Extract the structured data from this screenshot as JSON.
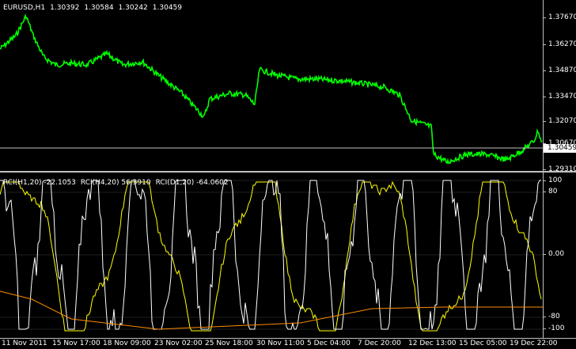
{
  "header": {
    "symbol": "EURUSD,H1",
    "open": "1.30392",
    "high": "1.30584",
    "low": "1.30242",
    "close": "1.30459"
  },
  "price_axis": {
    "ticks": [
      "1.37670",
      "1.36270",
      "1.34870",
      "1.33470",
      "1.32070",
      "1.30670",
      "1.29310"
    ],
    "bid": "1.30459",
    "bid_box_color": "#ffffff"
  },
  "indicator": {
    "label_1": "RCI(H1,20) -22.1053",
    "label_2": "RCI(H4,20) 56.3910",
    "label_3": "RCI(D1,20) -64.0602",
    "ticks": [
      "100",
      "80",
      "0.00",
      "-80",
      "-100"
    ],
    "colors": {
      "h1": "#ffffff",
      "h4": "#ffff00",
      "d1": "#ff8c00"
    }
  },
  "time_axis": {
    "labels": [
      "11 Nov 2011",
      "15 Nov 17:00",
      "18 Nov 09:00",
      "23 Nov 02:00",
      "25 Nov 18:00",
      "30 Nov 11:00",
      "5 Dec 04:00",
      "7 Dec 20:00",
      "12 Dec 13:00",
      "15 Dec 05:00",
      "19 Dec 22:00"
    ]
  },
  "colors": {
    "price_line": "#00ff00",
    "background": "#000000",
    "separator": "#c0c0c0"
  }
}
